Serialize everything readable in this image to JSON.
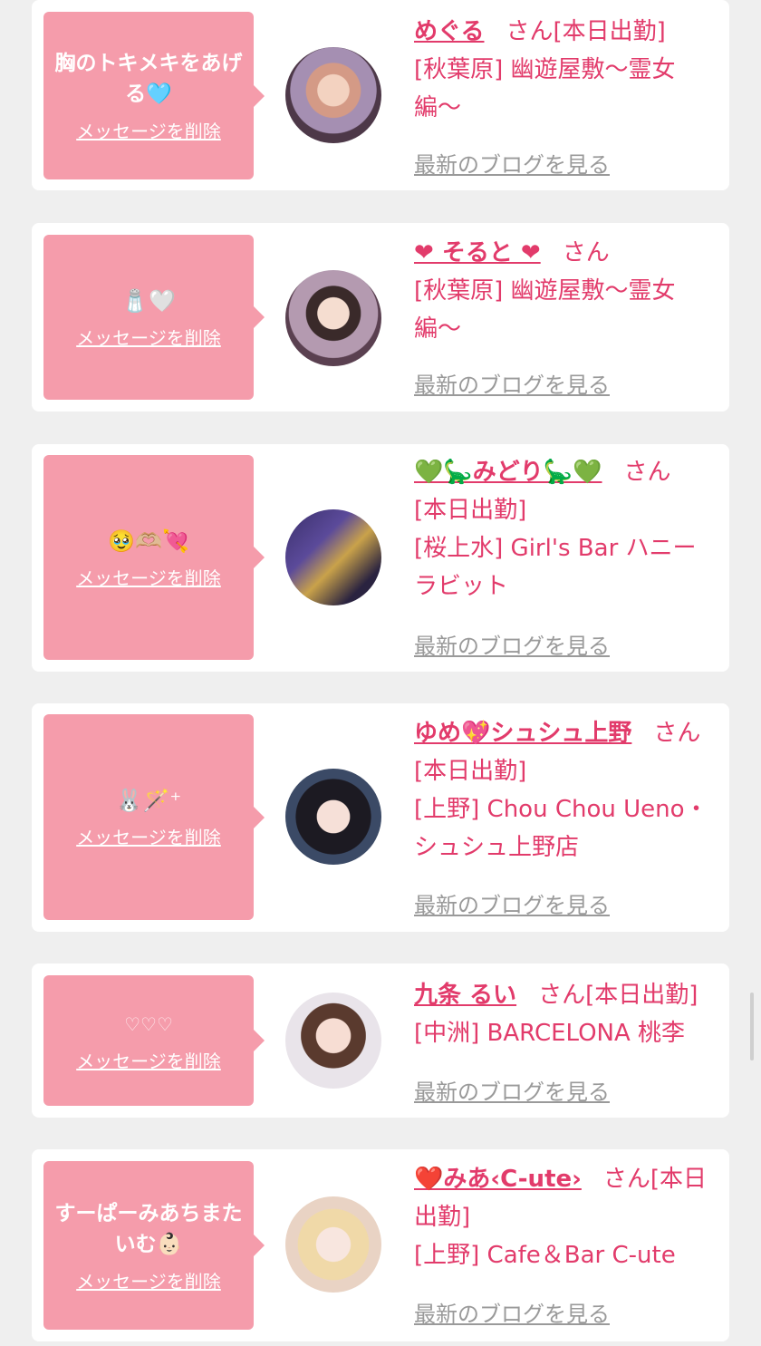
{
  "delete_label": "メッセージを削除",
  "blog_label": "最新のブログを見る",
  "san_label": "さん",
  "entries": [
    {
      "message": "胸のトキメキをあげる🩵",
      "name": "めぐる",
      "suffix": "[本日出勤]",
      "shop": "[秋葉原] 幽遊屋敷〜霊女編〜"
    },
    {
      "message": "🧂🤍",
      "name": "❤ そると ❤",
      "suffix": "",
      "shop": "[秋葉原] 幽遊屋敷〜霊女編〜"
    },
    {
      "message": "🥹🫶🏼💘",
      "name": "💚🦕みどり🦕💚",
      "suffix": "[本日出勤]",
      "shop": "[桜上水] Girl's Bar ハニーラビット"
    },
    {
      "message": "🐰🪄⁺",
      "name": "ゆめ💖シュシュ上野",
      "suffix": "[本日出勤]",
      "shop": "[上野] Chou Chou Ueno・シュシュ上野店"
    },
    {
      "message": "♡♡♡",
      "name": "九条 るい",
      "suffix": "[本日出勤]",
      "shop": "[中洲] BARCELONA 桃李"
    },
    {
      "message": "すーぱーみあちまたいむ👶🏻",
      "name": "❤️みあ‹C-ute›",
      "suffix": "[本日出勤]",
      "shop": "[上野] Cafe＆Bar C-ute"
    }
  ]
}
